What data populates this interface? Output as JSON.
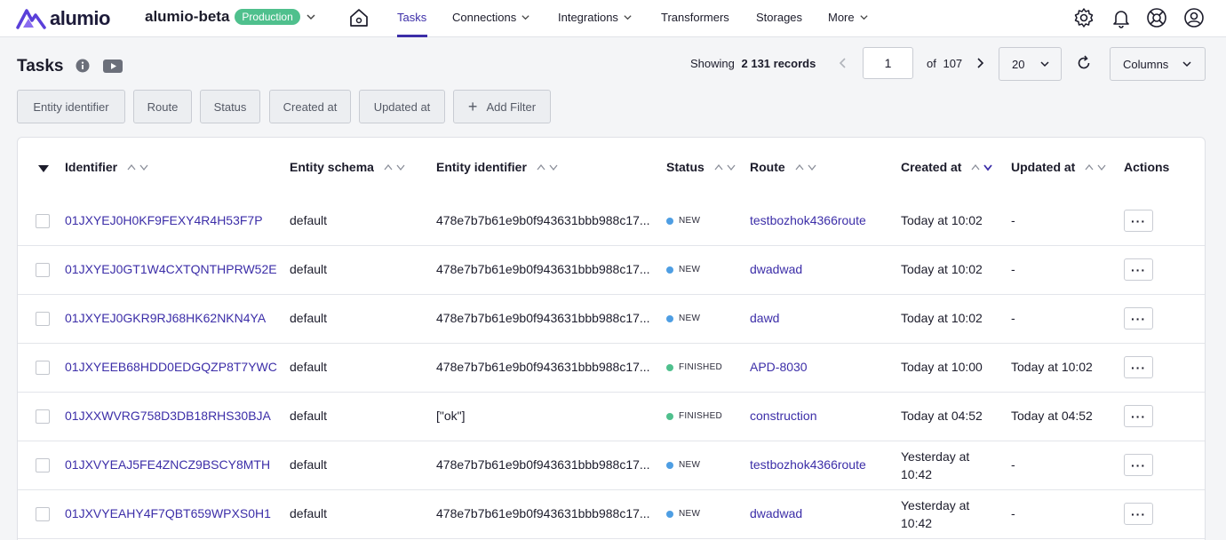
{
  "brand": {
    "logo_text": "alumio",
    "accent": "#3c2ea8",
    "logo_color": "#5a3fd9"
  },
  "workspace": {
    "name": "alumio-beta",
    "environment": "Production",
    "env_color": "#4fc08d"
  },
  "nav": {
    "home_icon": "home-icon",
    "items": [
      {
        "label": "Tasks",
        "active": true,
        "has_dropdown": false
      },
      {
        "label": "Connections",
        "active": false,
        "has_dropdown": true
      },
      {
        "label": "Integrations",
        "active": false,
        "has_dropdown": true
      },
      {
        "label": "Transformers",
        "active": false,
        "has_dropdown": false
      },
      {
        "label": "Storages",
        "active": false,
        "has_dropdown": false
      },
      {
        "label": "More",
        "active": false,
        "has_dropdown": true
      }
    ],
    "right_icons": [
      "gear-icon",
      "bell-icon",
      "help-icon",
      "user-icon"
    ]
  },
  "page": {
    "title": "Tasks",
    "showing_label": "Showing",
    "records": "2 131 records",
    "current_page": "1",
    "of_label": "of",
    "total_pages": "107",
    "page_size": "20",
    "columns_label": "Columns"
  },
  "filters": [
    "Entity identifier",
    "Route",
    "Status",
    "Created at",
    "Updated at"
  ],
  "add_filter_label": "Add Filter",
  "table": {
    "headers": {
      "identifier": "Identifier",
      "entity_schema": "Entity schema",
      "entity_identifier": "Entity identifier",
      "status": "Status",
      "route": "Route",
      "created_at": "Created at",
      "updated_at": "Updated at",
      "actions": "Actions"
    },
    "sorted_column": "created_at",
    "sort_direction": "desc",
    "rows": [
      {
        "identifier": "01JXYEJ0H0KF9FEXY4R4H53F7P",
        "schema": "default",
        "entity_identifier": "478e7b7b61e9b0f943631bbb988c17...",
        "status": "NEW",
        "route": "testbozhok4366route",
        "created": "Today at 10:02",
        "updated": "-"
      },
      {
        "identifier": "01JXYEJ0GT1W4CXTQNTHPRW52E",
        "schema": "default",
        "entity_identifier": "478e7b7b61e9b0f943631bbb988c17...",
        "status": "NEW",
        "route": "dwadwad",
        "created": "Today at 10:02",
        "updated": "-"
      },
      {
        "identifier": "01JXYEJ0GKR9RJ68HK62NKN4YA",
        "schema": "default",
        "entity_identifier": "478e7b7b61e9b0f943631bbb988c17...",
        "status": "NEW",
        "route": "dawd",
        "created": "Today at 10:02",
        "updated": "-"
      },
      {
        "identifier": "01JXYEEB68HDD0EDGQZP8T7YWC",
        "schema": "default",
        "entity_identifier": "478e7b7b61e9b0f943631bbb988c17...",
        "status": "FINISHED",
        "route": "APD-8030",
        "created": "Today at 10:00",
        "updated": "Today at 10:02"
      },
      {
        "identifier": "01JXXWVRG758D3DB18RHS30BJA",
        "schema": "default",
        "entity_identifier": "[\"ok\"]",
        "status": "FINISHED",
        "route": "construction",
        "created": "Today at 04:52",
        "updated": "Today at 04:52"
      },
      {
        "identifier": "01JXVYEAJ5FE4ZNCZ9BSCY8MTH",
        "schema": "default",
        "entity_identifier": "478e7b7b61e9b0f943631bbb988c17...",
        "status": "NEW",
        "route": "testbozhok4366route",
        "created": "Yesterday at 10:42",
        "updated": "-"
      },
      {
        "identifier": "01JXVYEAHY4F7QBT659WPXS0H1",
        "schema": "default",
        "entity_identifier": "478e7b7b61e9b0f943631bbb988c17...",
        "status": "NEW",
        "route": "dwadwad",
        "created": "Yesterday at 10:42",
        "updated": "-"
      }
    ]
  },
  "status_colors": {
    "NEW": "#4e9ee3",
    "FINISHED": "#4fc08d"
  }
}
